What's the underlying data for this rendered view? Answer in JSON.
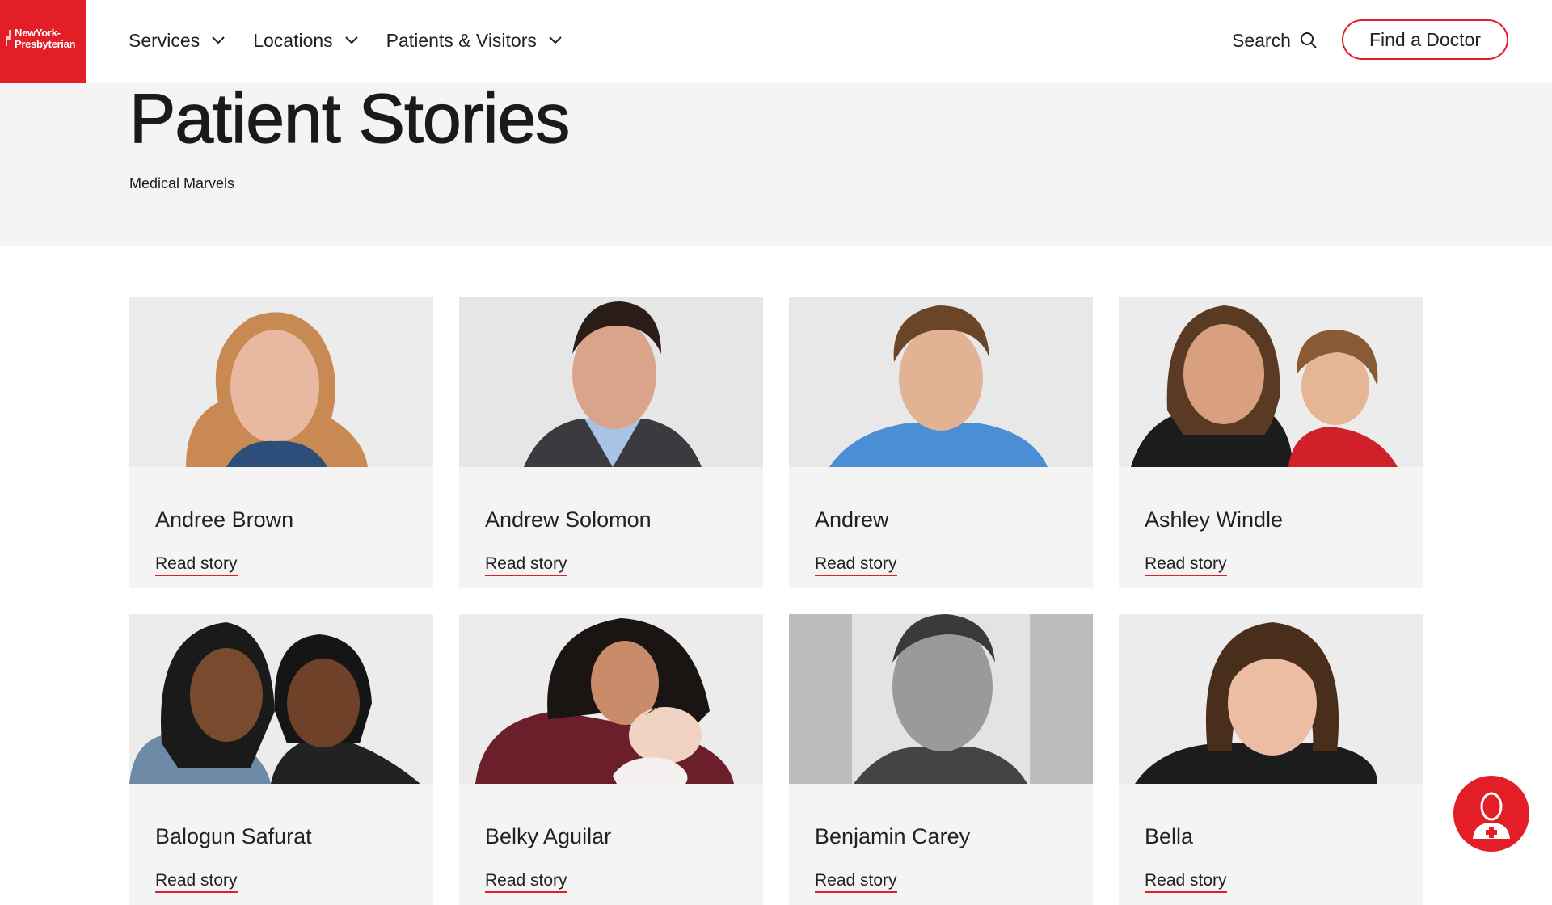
{
  "brand": {
    "logo_line1": "NewYork-",
    "logo_line2": "Presbyterian",
    "accent": "#e31e27"
  },
  "nav": {
    "items": [
      {
        "label": "Services"
      },
      {
        "label": "Locations"
      },
      {
        "label": "Patients & Visitors"
      }
    ],
    "search_label": "Search",
    "find_doctor_label": "Find a Doctor"
  },
  "hero": {
    "title": "Patient Stories",
    "link": "Medical Marvels"
  },
  "stories": [
    {
      "name": "Andree Brown",
      "cta": "Read story"
    },
    {
      "name": "Andrew Solomon",
      "cta": "Read story"
    },
    {
      "name": "Andrew",
      "cta": "Read story"
    },
    {
      "name": "Ashley Windle",
      "cta": "Read story"
    },
    {
      "name": "Balogun Safurat",
      "cta": "Read story"
    },
    {
      "name": "Belky Aguilar",
      "cta": "Read story"
    },
    {
      "name": "Benjamin Carey",
      "cta": "Read story"
    },
    {
      "name": "Bella",
      "cta": "Read story"
    }
  ],
  "icons": {
    "nav_chevron": "chevron-down-icon",
    "search": "search-icon",
    "chat": "virtual-assistant-icon"
  }
}
